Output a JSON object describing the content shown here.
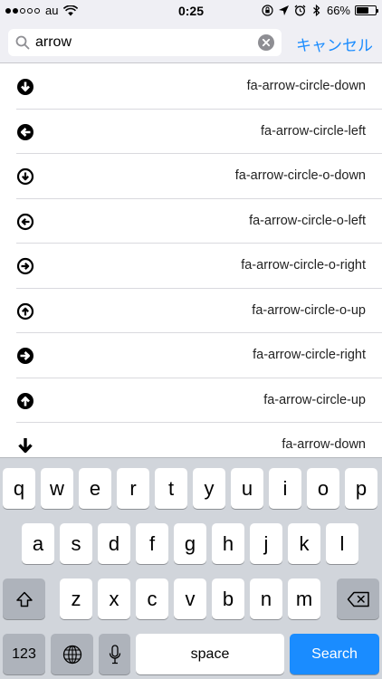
{
  "status_bar": {
    "carrier": "au",
    "time": "0:25",
    "battery": "66%"
  },
  "search": {
    "value": "arrow",
    "cancel_label": "キャンセル"
  },
  "results": [
    {
      "label": "fa-arrow-circle-down",
      "icon": "arrow-circle-down-icon"
    },
    {
      "label": "fa-arrow-circle-left",
      "icon": "arrow-circle-left-icon"
    },
    {
      "label": "fa-arrow-circle-o-down",
      "icon": "arrow-circle-o-down-icon"
    },
    {
      "label": "fa-arrow-circle-o-left",
      "icon": "arrow-circle-o-left-icon"
    },
    {
      "label": "fa-arrow-circle-o-right",
      "icon": "arrow-circle-o-right-icon"
    },
    {
      "label": "fa-arrow-circle-o-up",
      "icon": "arrow-circle-o-up-icon"
    },
    {
      "label": "fa-arrow-circle-right",
      "icon": "arrow-circle-right-icon"
    },
    {
      "label": "fa-arrow-circle-up",
      "icon": "arrow-circle-up-icon"
    },
    {
      "label": "fa-arrow-down",
      "icon": "arrow-down-icon"
    }
  ],
  "keyboard": {
    "row1": [
      "q",
      "w",
      "e",
      "r",
      "t",
      "y",
      "u",
      "i",
      "o",
      "p"
    ],
    "row2": [
      "a",
      "s",
      "d",
      "f",
      "g",
      "h",
      "j",
      "k",
      "l"
    ],
    "row3": [
      "z",
      "x",
      "c",
      "v",
      "b",
      "n",
      "m"
    ],
    "numbers_label": "123",
    "space_label": "space",
    "search_label": "Search"
  },
  "colors": {
    "accent": "#1a8cff",
    "keyboard_bg": "#d1d5db"
  }
}
